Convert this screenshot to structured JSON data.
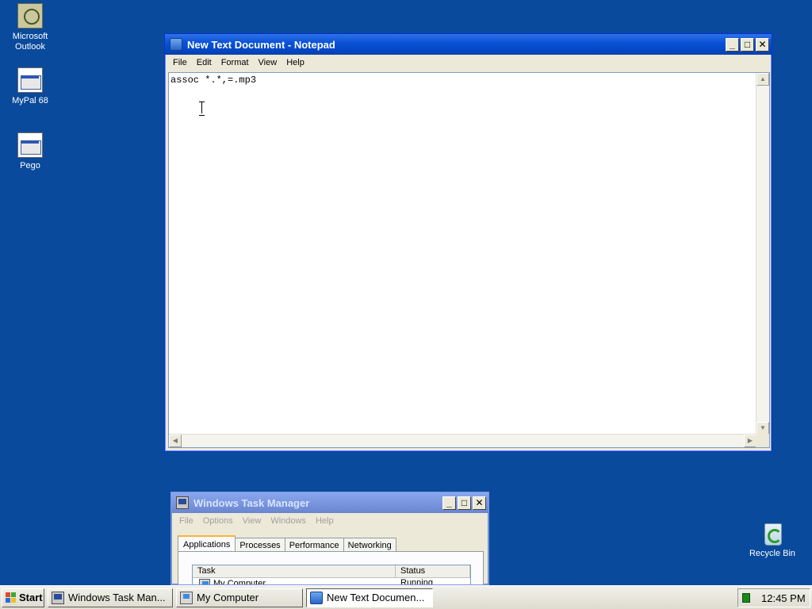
{
  "desktop": {
    "icons": [
      {
        "label_line1": "Microsoft",
        "label_line2": "Outlook",
        "icon": "outlook-icon"
      },
      {
        "label": "MyPal 68",
        "icon": "application-icon"
      },
      {
        "label": "Pego",
        "icon": "application-icon"
      },
      {
        "label": "Recycle Bin",
        "icon": "recycle-bin-icon"
      }
    ]
  },
  "notepad": {
    "title": "New Text Document - Notepad",
    "menu": [
      "File",
      "Edit",
      "Format",
      "View",
      "Help"
    ],
    "content": "assoc *.*,=.mp3",
    "controls": {
      "minimize": "_",
      "maximize": "□",
      "close": "✕"
    }
  },
  "taskmgr": {
    "title": "Windows Task Manager",
    "menu": [
      "File",
      "Options",
      "View",
      "Windows",
      "Help"
    ],
    "tabs": [
      "Applications",
      "Processes",
      "Performance",
      "Networking"
    ],
    "active_tab": "Applications",
    "columns": [
      "Task",
      "Status"
    ],
    "rows": [
      {
        "task": "My Computer",
        "status": "Running"
      }
    ]
  },
  "taskbar": {
    "start_label": "Start",
    "buttons": [
      {
        "label": "Windows Task Man...",
        "icon": "task-manager-icon"
      },
      {
        "label": "My Computer",
        "icon": "my-computer-icon"
      },
      {
        "label": "New Text Documen...",
        "icon": "notepad-icon",
        "active": true
      }
    ],
    "clock": "12:45 PM"
  },
  "colors": {
    "desktop_bg": "#0a4a9c",
    "titlebar_active": "#0a53d8",
    "titlebar_inactive": "#7a96df"
  }
}
